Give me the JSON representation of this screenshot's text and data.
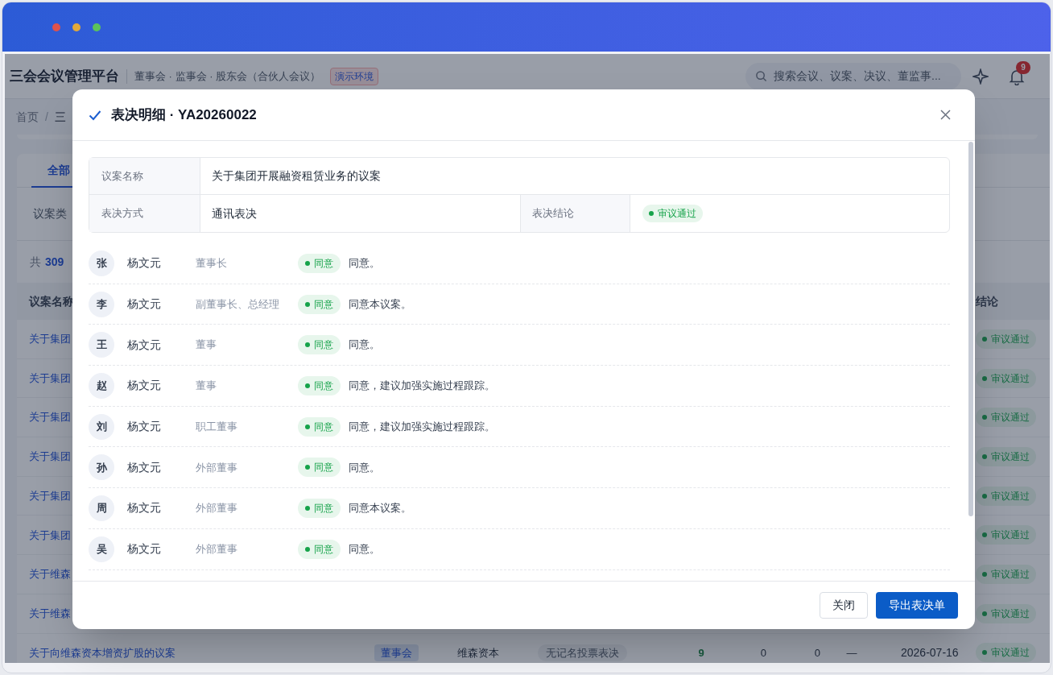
{
  "window": {
    "dots": [
      {
        "color": "#e0524a"
      },
      {
        "color": "#e3a93a"
      },
      {
        "color": "#5cc35a"
      }
    ]
  },
  "app": {
    "title": "三会会议管理平台",
    "subtitle": "董事会 · 监事会 · 股东会（合伙人会议）",
    "env_badge": "演示环境",
    "search": {
      "placeholder": "搜索会议、议案、决议、董监事..."
    },
    "notification_count": "9"
  },
  "breadcrumb": {
    "items": [
      "首页",
      "三"
    ],
    "separator": "/"
  },
  "tabs": [
    {
      "label": "全部",
      "selected": true
    }
  ],
  "filter_label": "议案类",
  "total": {
    "prefix": "共",
    "count": "309"
  },
  "table": {
    "columns": [
      "议案名称",
      "结论"
    ],
    "rows": [
      {
        "name": "关于集团",
        "conclusion": "审议通过"
      },
      {
        "name": "关于集团",
        "conclusion": "审议通过"
      },
      {
        "name": "关于集团",
        "conclusion": "审议通过"
      },
      {
        "name": "关于集团",
        "conclusion": "审议通过"
      },
      {
        "name": "关于集团",
        "conclusion": "审议通过"
      },
      {
        "name": "关于集团",
        "conclusion": "审议通过"
      },
      {
        "name": "关于维森",
        "conclusion": "审议通过"
      },
      {
        "name": "关于维森",
        "conclusion": "审议通过"
      },
      {
        "name": "关于向维森资本增资扩股的议案",
        "conclusion": "审议通过",
        "details": {
          "body_tag": "董事会",
          "company": "维森资本",
          "method_tag": "无记名投票表决",
          "count_1": "9",
          "count_2": "0",
          "count_3": "0",
          "remark": "—",
          "date": "2026-07-16"
        }
      }
    ]
  },
  "dialog": {
    "title": "表决明细 · YA20260022",
    "info": {
      "proposal_label": "议案名称",
      "proposal": "关于集团开展融资租赁业务的议案",
      "method_label": "表决方式",
      "method": "通讯表决",
      "result_label": "表决结论",
      "result": "审议通过"
    },
    "votes": [
      {
        "avatar": "张",
        "name": "杨文元",
        "role": "董事长",
        "vote": "同意",
        "kind": "agree",
        "comment": "同意。"
      },
      {
        "avatar": "李",
        "name": "杨文元",
        "role": "副董事长、总经理",
        "vote": "同意",
        "kind": "agree",
        "comment": "同意本议案。"
      },
      {
        "avatar": "王",
        "name": "杨文元",
        "role": "董事",
        "vote": "同意",
        "kind": "agree",
        "comment": "同意。"
      },
      {
        "avatar": "赵",
        "name": "杨文元",
        "role": "董事",
        "vote": "同意",
        "kind": "agree",
        "comment": "同意，建议加强实施过程跟踪。"
      },
      {
        "avatar": "刘",
        "name": "杨文元",
        "role": "职工董事",
        "vote": "同意",
        "kind": "agree",
        "comment": "同意，建议加强实施过程跟踪。"
      },
      {
        "avatar": "孙",
        "name": "杨文元",
        "role": "外部董事",
        "vote": "同意",
        "kind": "agree",
        "comment": "同意。"
      },
      {
        "avatar": "周",
        "name": "杨文元",
        "role": "外部董事",
        "vote": "同意",
        "kind": "agree",
        "comment": "同意本议案。"
      },
      {
        "avatar": "吴",
        "name": "杨文元",
        "role": "外部董事",
        "vote": "同意",
        "kind": "agree",
        "comment": "同意。"
      }
    ],
    "buttons": [
      {
        "label": "关闭",
        "kind": "secondary"
      },
      {
        "label": "导出表决单",
        "kind": "primary"
      }
    ]
  }
}
